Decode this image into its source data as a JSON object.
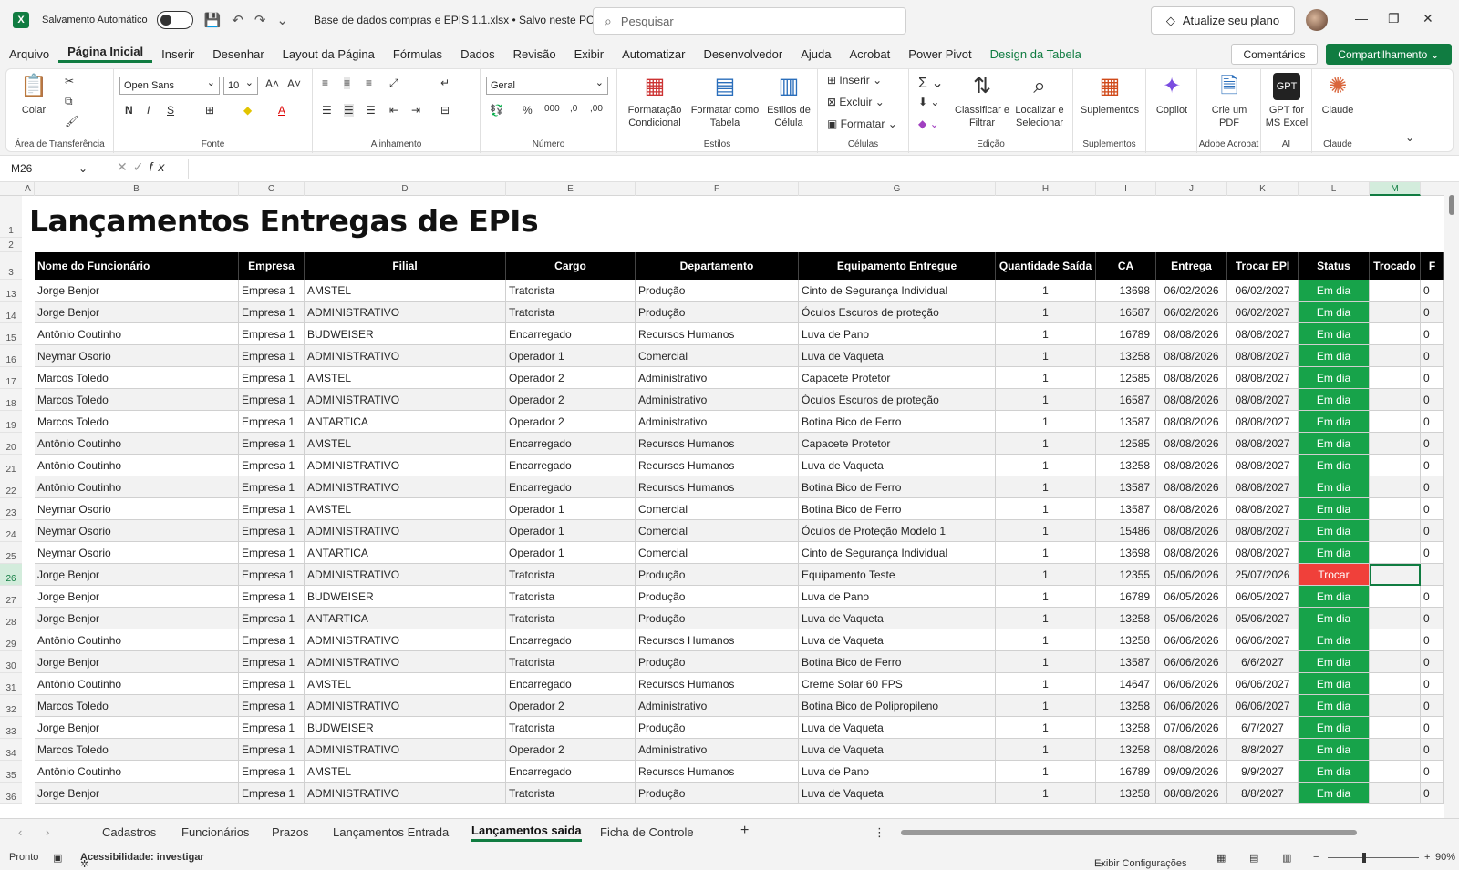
{
  "titlebar": {
    "autosave_label": "Salvamento Automático",
    "doc_title": "Base de dados compras e EPIS 1.1.xlsx • Salvo neste PC ⌄",
    "search_placeholder": "Pesquisar",
    "upgrade_label": "Atualize seu plano"
  },
  "menu": {
    "tabs": [
      "Arquivo",
      "Página Inicial",
      "Inserir",
      "Desenhar",
      "Layout da Página",
      "Fórmulas",
      "Dados",
      "Revisão",
      "Exibir",
      "Automatizar",
      "Desenvolvedor",
      "Ajuda",
      "Acrobat",
      "Power Pivot",
      "Design da Tabela"
    ],
    "comments_label": "Comentários",
    "share_label": "Compartilhamento"
  },
  "ribbon": {
    "paste_label": "Colar",
    "clipboard_group": "Área de Transferência",
    "font_name": "Open Sans",
    "font_size": "10",
    "font_group": "Fonte",
    "alignment_group": "Alinhamento",
    "number_format": "Geral",
    "number_group": "Número",
    "cond_format_label": "Formatação Condicional",
    "format_table_label": "Formatar como Tabela",
    "cell_styles_label": "Estilos de Célula",
    "styles_group": "Estilos",
    "insert_label": "Inserir",
    "delete_label": "Excluir",
    "format_label": "Formatar",
    "cells_group": "Células",
    "sort_label": "Classificar e Filtrar",
    "find_label": "Localizar e Selecionar",
    "editing_group": "Edição",
    "addins_label": "Suplementos",
    "addins_group": "Suplementos",
    "copilot_label": "Copilot",
    "pdf_label": "Crie um PDF",
    "acrobat_group": "Adobe Acrobat",
    "gpt_label": "GPT for MS Excel",
    "ai_group": "AI",
    "claude_label": "Claude",
    "claude_group": "Claude"
  },
  "formula": {
    "namebox": "M26",
    "fx_label": "fx"
  },
  "columns": [
    "A",
    "B",
    "C",
    "D",
    "E",
    "F",
    "G",
    "H",
    "I",
    "J",
    "K",
    "L",
    "M"
  ],
  "sheet_title": "Lançamentos Entregas de EPIs",
  "table": {
    "headers": [
      "Nome do Funcionário",
      "Empresa",
      "Filial",
      "Cargo",
      "Departamento",
      "Equipamento Entregue",
      "Quantidade Saída",
      "CA",
      "Entrega",
      "Trocar EPI",
      "Status",
      "Trocado",
      "F"
    ],
    "rows": [
      {
        "n": "13",
        "c": [
          "Jorge Benjor",
          "Empresa 1",
          "AMSTEL",
          "Tratorista",
          "Produção",
          "Cinto de Segurança Individual",
          "1",
          "13698",
          "06/02/2026",
          "06/02/2027",
          "Em dia",
          "",
          "0"
        ]
      },
      {
        "n": "14",
        "c": [
          "Jorge Benjor",
          "Empresa 1",
          "ADMINISTRATIVO",
          "Tratorista",
          "Produção",
          "Óculos Escuros de proteção",
          "1",
          "16587",
          "06/02/2026",
          "06/02/2027",
          "Em dia",
          "",
          "0"
        ]
      },
      {
        "n": "15",
        "c": [
          "Antônio Coutinho",
          "Empresa 1",
          "BUDWEISER",
          "Encarregado",
          "Recursos Humanos",
          "Luva de Pano",
          "1",
          "16789",
          "08/08/2026",
          "08/08/2027",
          "Em dia",
          "",
          "0"
        ]
      },
      {
        "n": "16",
        "c": [
          "Neymar Osorio",
          "Empresa 1",
          "ADMINISTRATIVO",
          "Operador 1",
          "Comercial",
          "Luva de Vaqueta",
          "1",
          "13258",
          "08/08/2026",
          "08/08/2027",
          "Em dia",
          "",
          "0"
        ]
      },
      {
        "n": "17",
        "c": [
          "Marcos Toledo",
          "Empresa 1",
          "AMSTEL",
          "Operador 2",
          "Administrativo",
          "Capacete Protetor",
          "1",
          "12585",
          "08/08/2026",
          "08/08/2027",
          "Em dia",
          "",
          "0"
        ]
      },
      {
        "n": "18",
        "c": [
          "Marcos Toledo",
          "Empresa 1",
          "ADMINISTRATIVO",
          "Operador 2",
          "Administrativo",
          "Óculos Escuros de proteção",
          "1",
          "16587",
          "08/08/2026",
          "08/08/2027",
          "Em dia",
          "",
          "0"
        ]
      },
      {
        "n": "19",
        "c": [
          "Marcos Toledo",
          "Empresa 1",
          "ANTARTICA",
          "Operador 2",
          "Administrativo",
          "Botina Bico de Ferro",
          "1",
          "13587",
          "08/08/2026",
          "08/08/2027",
          "Em dia",
          "",
          "0"
        ]
      },
      {
        "n": "20",
        "c": [
          "Antônio Coutinho",
          "Empresa 1",
          "AMSTEL",
          "Encarregado",
          "Recursos Humanos",
          "Capacete Protetor",
          "1",
          "12585",
          "08/08/2026",
          "08/08/2027",
          "Em dia",
          "",
          "0"
        ]
      },
      {
        "n": "21",
        "c": [
          "Antônio Coutinho",
          "Empresa 1",
          "ADMINISTRATIVO",
          "Encarregado",
          "Recursos Humanos",
          "Luva de Vaqueta",
          "1",
          "13258",
          "08/08/2026",
          "08/08/2027",
          "Em dia",
          "",
          "0"
        ]
      },
      {
        "n": "22",
        "c": [
          "Antônio Coutinho",
          "Empresa 1",
          "ADMINISTRATIVO",
          "Encarregado",
          "Recursos Humanos",
          "Botina Bico de Ferro",
          "1",
          "13587",
          "08/08/2026",
          "08/08/2027",
          "Em dia",
          "",
          "0"
        ]
      },
      {
        "n": "23",
        "c": [
          "Neymar Osorio",
          "Empresa 1",
          "AMSTEL",
          "Operador 1",
          "Comercial",
          "Botina Bico de Ferro",
          "1",
          "13587",
          "08/08/2026",
          "08/08/2027",
          "Em dia",
          "",
          "0"
        ]
      },
      {
        "n": "24",
        "c": [
          "Neymar Osorio",
          "Empresa 1",
          "ADMINISTRATIVO",
          "Operador 1",
          "Comercial",
          "Óculos de Proteção Modelo 1",
          "1",
          "15486",
          "08/08/2026",
          "08/08/2027",
          "Em dia",
          "",
          "0"
        ]
      },
      {
        "n": "25",
        "c": [
          "Neymar Osorio",
          "Empresa 1",
          "ANTARTICA",
          "Operador 1",
          "Comercial",
          "Cinto de Segurança Individual",
          "1",
          "13698",
          "08/08/2026",
          "08/08/2027",
          "Em dia",
          "",
          "0"
        ]
      },
      {
        "n": "26",
        "c": [
          "Jorge Benjor",
          "Empresa 1",
          "ADMINISTRATIVO",
          "Tratorista",
          "Produção",
          "Equipamento Teste",
          "1",
          "12355",
          "05/06/2026",
          "25/07/2026",
          "Trocar",
          "",
          ""
        ]
      },
      {
        "n": "27",
        "c": [
          "Jorge Benjor",
          "Empresa 1",
          "BUDWEISER",
          "Tratorista",
          "Produção",
          "Luva de Pano",
          "1",
          "16789",
          "06/05/2026",
          "06/05/2027",
          "Em dia",
          "",
          "0"
        ]
      },
      {
        "n": "28",
        "c": [
          "Jorge Benjor",
          "Empresa 1",
          "ANTARTICA",
          "Tratorista",
          "Produção",
          "Luva de Vaqueta",
          "1",
          "13258",
          "05/06/2026",
          "05/06/2027",
          "Em dia",
          "",
          "0"
        ]
      },
      {
        "n": "29",
        "c": [
          "Antônio Coutinho",
          "Empresa 1",
          "ADMINISTRATIVO",
          "Encarregado",
          "Recursos Humanos",
          "Luva de Vaqueta",
          "1",
          "13258",
          "06/06/2026",
          "06/06/2027",
          "Em dia",
          "",
          "0"
        ]
      },
      {
        "n": "30",
        "c": [
          "Jorge Benjor",
          "Empresa 1",
          "ADMINISTRATIVO",
          "Tratorista",
          "Produção",
          "Botina Bico de Ferro",
          "1",
          "13587",
          "06/06/2026",
          "6/6/2027",
          "Em dia",
          "",
          "0"
        ]
      },
      {
        "n": "31",
        "c": [
          "Antônio Coutinho",
          "Empresa 1",
          "AMSTEL",
          "Encarregado",
          "Recursos Humanos",
          "Creme Solar 60 FPS",
          "1",
          "14647",
          "06/06/2026",
          "06/06/2027",
          "Em dia",
          "",
          "0"
        ]
      },
      {
        "n": "32",
        "c": [
          "Marcos Toledo",
          "Empresa 1",
          "ADMINISTRATIVO",
          "Operador 2",
          "Administrativo",
          "Botina Bico de Polipropileno",
          "1",
          "13258",
          "06/06/2026",
          "06/06/2027",
          "Em dia",
          "",
          "0"
        ]
      },
      {
        "n": "33",
        "c": [
          "Jorge Benjor",
          "Empresa 1",
          "BUDWEISER",
          "Tratorista",
          "Produção",
          "Luva de Vaqueta",
          "1",
          "13258",
          "07/06/2026",
          "6/7/2027",
          "Em dia",
          "",
          "0"
        ]
      },
      {
        "n": "34",
        "c": [
          "Marcos Toledo",
          "Empresa 1",
          "ADMINISTRATIVO",
          "Operador 2",
          "Administrativo",
          "Luva de Vaqueta",
          "1",
          "13258",
          "08/08/2026",
          "8/8/2027",
          "Em dia",
          "",
          "0"
        ]
      },
      {
        "n": "35",
        "c": [
          "Antônio Coutinho",
          "Empresa 1",
          "AMSTEL",
          "Encarregado",
          "Recursos Humanos",
          "Luva de Pano",
          "1",
          "16789",
          "09/09/2026",
          "9/9/2027",
          "Em dia",
          "",
          "0"
        ]
      },
      {
        "n": "36",
        "c": [
          "Jorge Benjor",
          "Empresa 1",
          "ADMINISTRATIVO",
          "Tratorista",
          "Produção",
          "Luva de Vaqueta",
          "1",
          "13258",
          "08/08/2026",
          "8/8/2027",
          "Em dia",
          "",
          "0"
        ]
      }
    ]
  },
  "status_colors": {
    "Em dia": "#17a34a",
    "Trocar": "#f0403a"
  },
  "sheets": [
    "Cadastros",
    "Funcionários",
    "Prazos",
    "Lançamentos Entrada",
    "Lançamentos saida",
    "Ficha de Controle"
  ],
  "active_sheet": "Lançamentos saida",
  "statusbar": {
    "ready": "Pronto",
    "accessibility": "Acessibilidade: investigar",
    "display_settings": "Exibir Configurações",
    "zoom": "90%"
  }
}
